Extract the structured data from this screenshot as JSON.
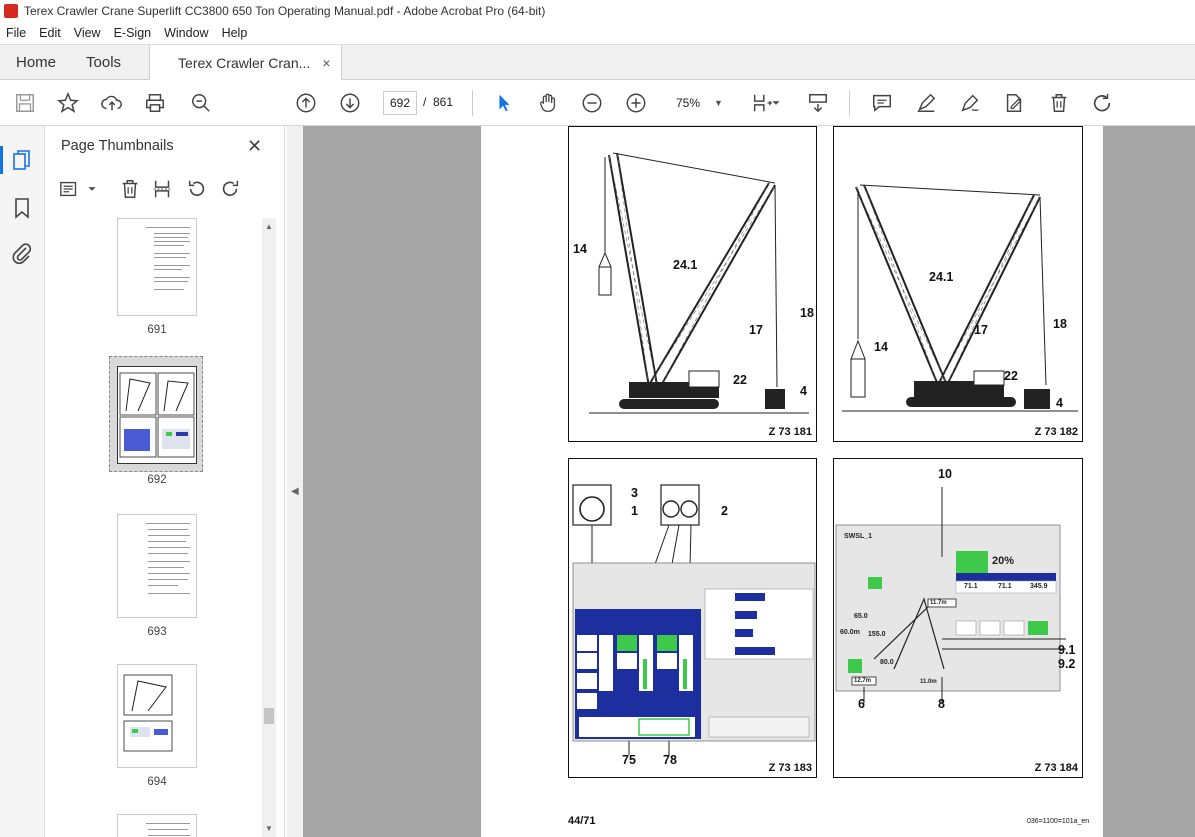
{
  "window": {
    "title": "Terex Crawler Crane Superlift CC3800 650 Ton Operating Manual.pdf - Adobe Acrobat Pro (64-bit)"
  },
  "menu": [
    "File",
    "Edit",
    "View",
    "E-Sign",
    "Window",
    "Help"
  ],
  "tabs": {
    "home": "Home",
    "tools": "Tools",
    "document": "Terex Crawler Cran...",
    "close": "×"
  },
  "toolbar": {
    "current_page": "692",
    "separator": "/",
    "page_count": "861",
    "zoom": "75%"
  },
  "thumbnails": {
    "title": "Page Thumbnails",
    "close": "✕",
    "pages": [
      "691",
      "692",
      "693",
      "694"
    ],
    "selected": "692"
  },
  "document": {
    "fig1": {
      "code": "Z 73 181",
      "callouts": [
        "14",
        "24.1",
        "17",
        "18",
        "22",
        "4"
      ]
    },
    "fig2": {
      "code": "Z 73 182",
      "callouts": [
        "24.1",
        "14",
        "17",
        "18",
        "22",
        "4"
      ]
    },
    "fig3": {
      "code": "Z 73 183",
      "callouts": [
        "3",
        "1",
        "2",
        "75",
        "78"
      ]
    },
    "fig4": {
      "code": "Z 73 184",
      "callouts": [
        "10",
        "9.1",
        "9.2",
        "6",
        "8"
      ],
      "screen": {
        "mode": "SWSL_1",
        "percent": "20%",
        "act": "71.1",
        "max": "71.1",
        "max2": "345.9",
        "radius_top": "11.7m",
        "boom": "60.0m",
        "width": "12.7m",
        "bottom": "11.0m",
        "angle1": "65.0",
        "angle2": "155.0",
        "angle3": "80.0"
      }
    },
    "page_number": "44/71",
    "doc_code": "036=1100=101a_en"
  },
  "colors": {
    "accent": "#1473e6",
    "acrobat_red": "#d62b1f",
    "viewer_bg": "#a5a5a5"
  }
}
